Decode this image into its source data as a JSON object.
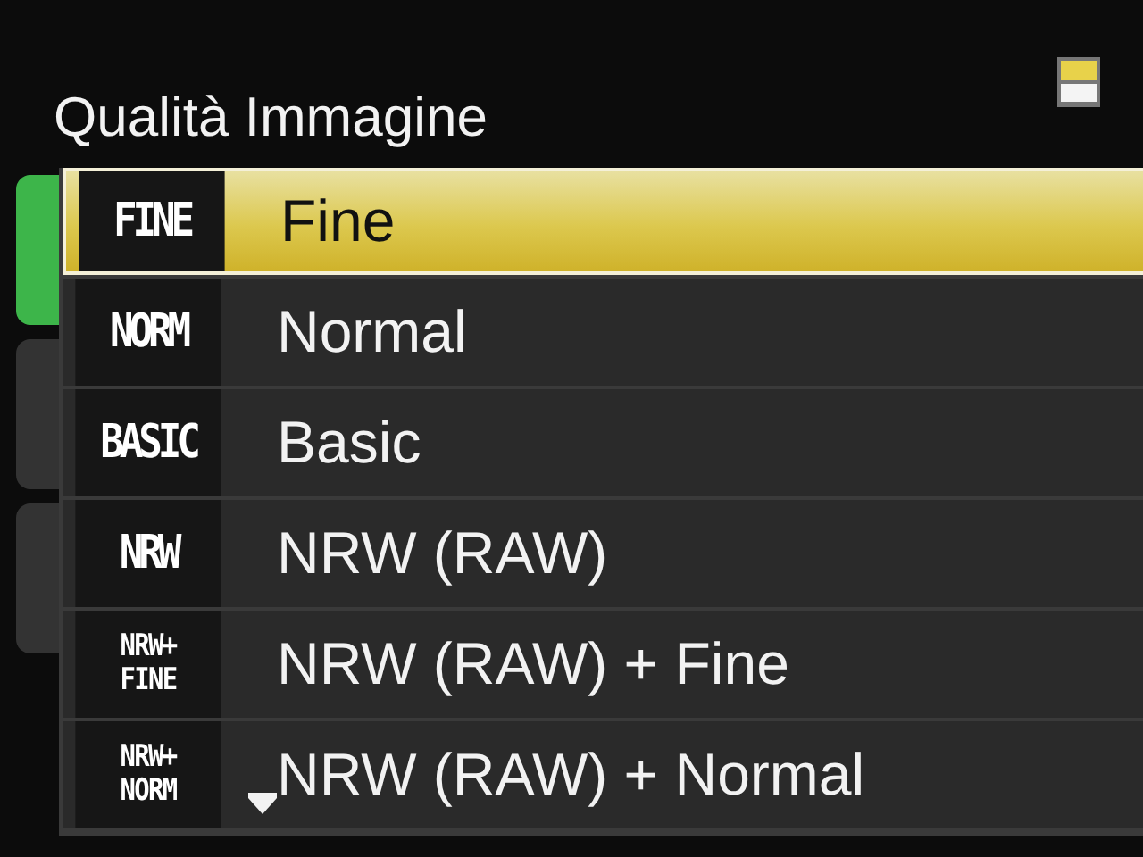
{
  "title": "Qualità Immagine",
  "side_tabs": [
    {
      "selected": true
    },
    {
      "selected": false
    },
    {
      "selected": false
    }
  ],
  "items": [
    {
      "badge": "FINE",
      "label": "Fine",
      "selected": true
    },
    {
      "badge": "NORM",
      "label": "Normal",
      "selected": false
    },
    {
      "badge": "BASIC",
      "label": "Basic",
      "selected": false
    },
    {
      "badge": "NRW",
      "label": "NRW (RAW)",
      "selected": false
    },
    {
      "badge": "NRW+\nFINE",
      "label": "NRW (RAW) + Fine",
      "selected": false
    },
    {
      "badge": "NRW+\nNORM",
      "label": "NRW (RAW) + Normal",
      "selected": false
    }
  ],
  "more_below": true
}
